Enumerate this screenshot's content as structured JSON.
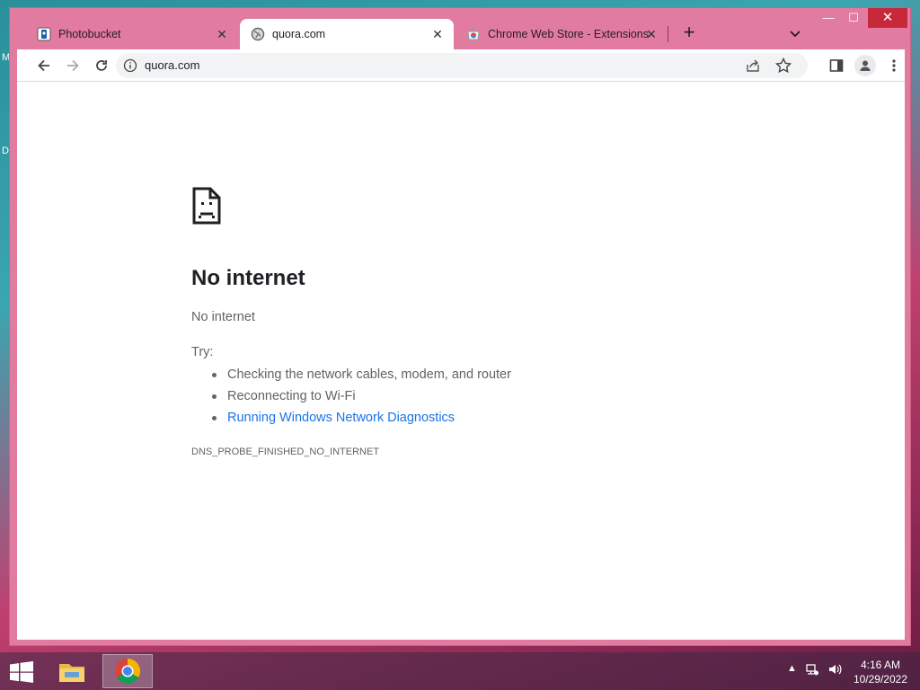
{
  "desktop": {
    "letters": [
      "M",
      "D"
    ]
  },
  "browser": {
    "tabs": [
      {
        "label": "Photobucket",
        "icon": "photobucket-icon"
      },
      {
        "label": "quora.com",
        "icon": "globe-icon",
        "active": true
      },
      {
        "label": "Chrome Web Store - Extensions",
        "icon": "chrome-web-store-icon"
      }
    ],
    "new_tab": "+",
    "window_controls": {
      "minimize": "—",
      "maximize": "☐",
      "close": "✕"
    },
    "toolbar": {
      "url": "quora.com"
    },
    "page": {
      "title": "No internet",
      "subtitle": "No internet",
      "try_label": "Try:",
      "suggestions": [
        "Checking the network cables, modem, and router",
        "Reconnecting to Wi-Fi",
        "Running Windows Network Diagnostics"
      ],
      "error_code": "DNS_PROBE_FINISHED_NO_INTERNET"
    }
  },
  "taskbar": {
    "apps": [
      "file-explorer-icon",
      "chrome-icon"
    ],
    "time": "4:16 AM",
    "date": "10/29/2022"
  },
  "colors": {
    "window_frame": "#e17ca0",
    "link": "#1a73e8"
  }
}
